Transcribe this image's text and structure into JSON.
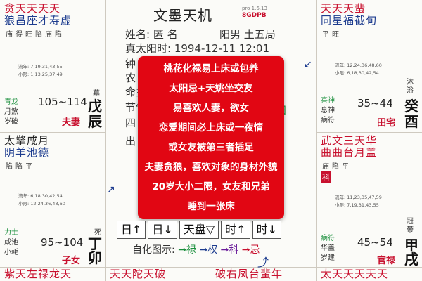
{
  "header": {
    "title": "文墨天机",
    "version": "pro 1.6.13",
    "code": "8GDPB"
  },
  "info": {
    "name": "姓名: 匿 名",
    "gender": "阳男 土五局",
    "true_solar": "真太阳时: 1994-12-11 12:01",
    "n1": "钟",
    "n2": "农",
    "n3": "命主",
    "n4": "节气",
    "n5": "四",
    "n6": "出",
    "n7": "田"
  },
  "overlay": {
    "lines": [
      "桃花化禄易上床或包养",
      "太阳忌+天姚坐交友",
      "易喜欢人妻，欲女",
      "恋爱期间必上床或一夜情",
      "或女友被第三者插足",
      "夫妻贪狼，喜欢对象的身材外貌",
      "20岁大小二限，女友和兄弟",
      "睡到一张床"
    ]
  },
  "toolbar": {
    "b1": "日↑",
    "b2": "日↓",
    "b3": "天盘▽",
    "b4": "时↑",
    "b5": "时↓"
  },
  "legend": {
    "prefix": "自化图示:",
    "a1": "→禄",
    "a2": "→权",
    "a3": "→科",
    "a4": "→忌"
  },
  "cells": {
    "chen": {
      "row1": "贪天天天天",
      "row2": "狼昌座才寿虚",
      "brite": "庙得旺陷庙陷",
      "liu": "流年: 7,19,31,43,55",
      "xiao": "小限: 1,13,25,37,49",
      "g1": "青龙",
      "g2": "月煞",
      "g3": "岁破",
      "range": "105~114",
      "palace": "夫妻",
      "stem1": "戊",
      "stem2": "辰",
      "life": "墓"
    },
    "mao": {
      "row1": "太擎咸月",
      "row2": "阴羊池德",
      "brite": "陷陷平",
      "liu": "流年: 6,18,30,42,54",
      "xiao": "小限: 12,24,36,48,60",
      "g1": "力士",
      "g2": "咸池",
      "g3": "小耗",
      "range": "95~104",
      "palace": "子女",
      "stem1": "丁",
      "stem2": "卯",
      "life": "死"
    },
    "you": {
      "row1": "天天天蜚",
      "row2": "同星福截旬",
      "brite": "平旺",
      "liu": "流年: 12,24,36,48,60",
      "xiao": "小限: 6,18,30,42,54",
      "g1": "喜神",
      "g2": "息神",
      "g3": "病符",
      "range": "35~44",
      "palace": "田宅",
      "stem1": "癸",
      "stem2": "酉",
      "life": "沐浴"
    },
    "xu": {
      "row1": "武文三天华",
      "row2": "曲曲台月盖",
      "brite": "庙陷平",
      "ke": "科",
      "liu": "流年: 11,23,35,47,59",
      "xiao": "小限: 7,19,31,43,55",
      "g1": "病符",
      "g2": "华盖",
      "g3": "岁建",
      "range": "45~54",
      "palace": "官禄",
      "stem1": "甲",
      "stem2": "戌",
      "life": "冠带"
    },
    "bottom": {
      "c1": "紫天左禄龙天",
      "c2": "天天陀天破",
      "c3": "破右凤台蜚年",
      "c4": "太天天天天天"
    }
  }
}
